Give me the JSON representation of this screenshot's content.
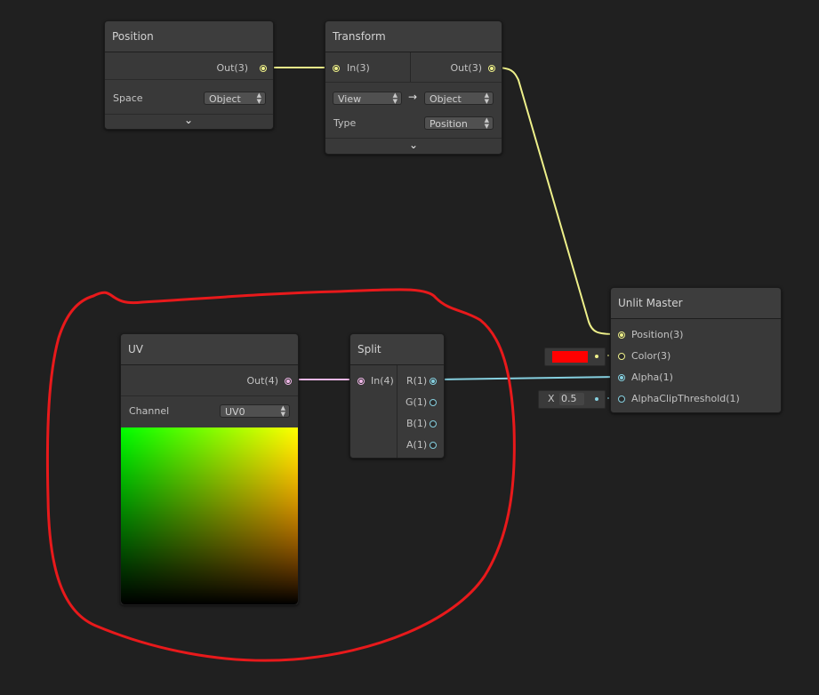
{
  "nodes": {
    "position": {
      "title": "Position",
      "out_port": "Out(3)",
      "space_label": "Space",
      "space_value": "Object"
    },
    "transform": {
      "title": "Transform",
      "in_port": "In(3)",
      "out_port": "Out(3)",
      "from_value": "View",
      "arrow": "→",
      "to_value": "Object",
      "type_label": "Type",
      "type_value": "Position"
    },
    "uv": {
      "title": "UV",
      "out_port": "Out(4)",
      "channel_label": "Channel",
      "channel_value": "UV0"
    },
    "split": {
      "title": "Split",
      "in_port": "In(4)",
      "out_ports": [
        "R(1)",
        "G(1)",
        "B(1)",
        "A(1)"
      ]
    },
    "unlit_master": {
      "title": "Unlit Master",
      "in_ports": [
        "Position(3)",
        "Color(3)",
        "Alpha(1)",
        "AlphaClipThreshold(1)"
      ]
    }
  },
  "inline_inputs": {
    "color_swatch": "#ff0000",
    "alpha_clip_axis": "X",
    "alpha_clip_value": "0.5"
  },
  "colors": {
    "vector3_wire": "#eef08a",
    "vector4_wire": "#f0b8e8",
    "vector1_wire": "#86d0e0",
    "annotation": "#e8191b"
  },
  "icons": {
    "expand": "chevron-down-icon",
    "dropdown": "updown-arrows-icon",
    "transform_arrow": "right-arrow-icon"
  }
}
